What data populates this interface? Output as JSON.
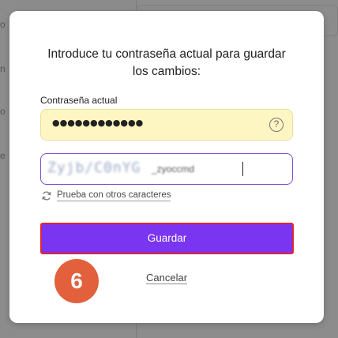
{
  "background": {
    "side_letters": [
      "o",
      "n",
      "o",
      "e"
    ]
  },
  "modal": {
    "title": "Introduce tu contraseña actual para guardar los cambios:",
    "current_password": {
      "label": "Contraseña actual",
      "masked_value": "●●●●●●●●●●●●",
      "help_icon": "question-circle-icon",
      "help_glyph": "?",
      "background_color": "#fdf6c3"
    },
    "new_password": {
      "blurred_value": "Zyjb/C0nYG",
      "blurred_suffix": "_zyoccmd"
    },
    "suggestion": {
      "icon": "refresh-icon",
      "text": "Prueba con otros caracteres"
    },
    "save_button": {
      "label": "Guardar",
      "color": "#7a35f0",
      "highlight_color": "#e0252f"
    },
    "step_badge": {
      "number": "6",
      "color": "#e2603b"
    },
    "cancel_link": "Cancelar"
  }
}
